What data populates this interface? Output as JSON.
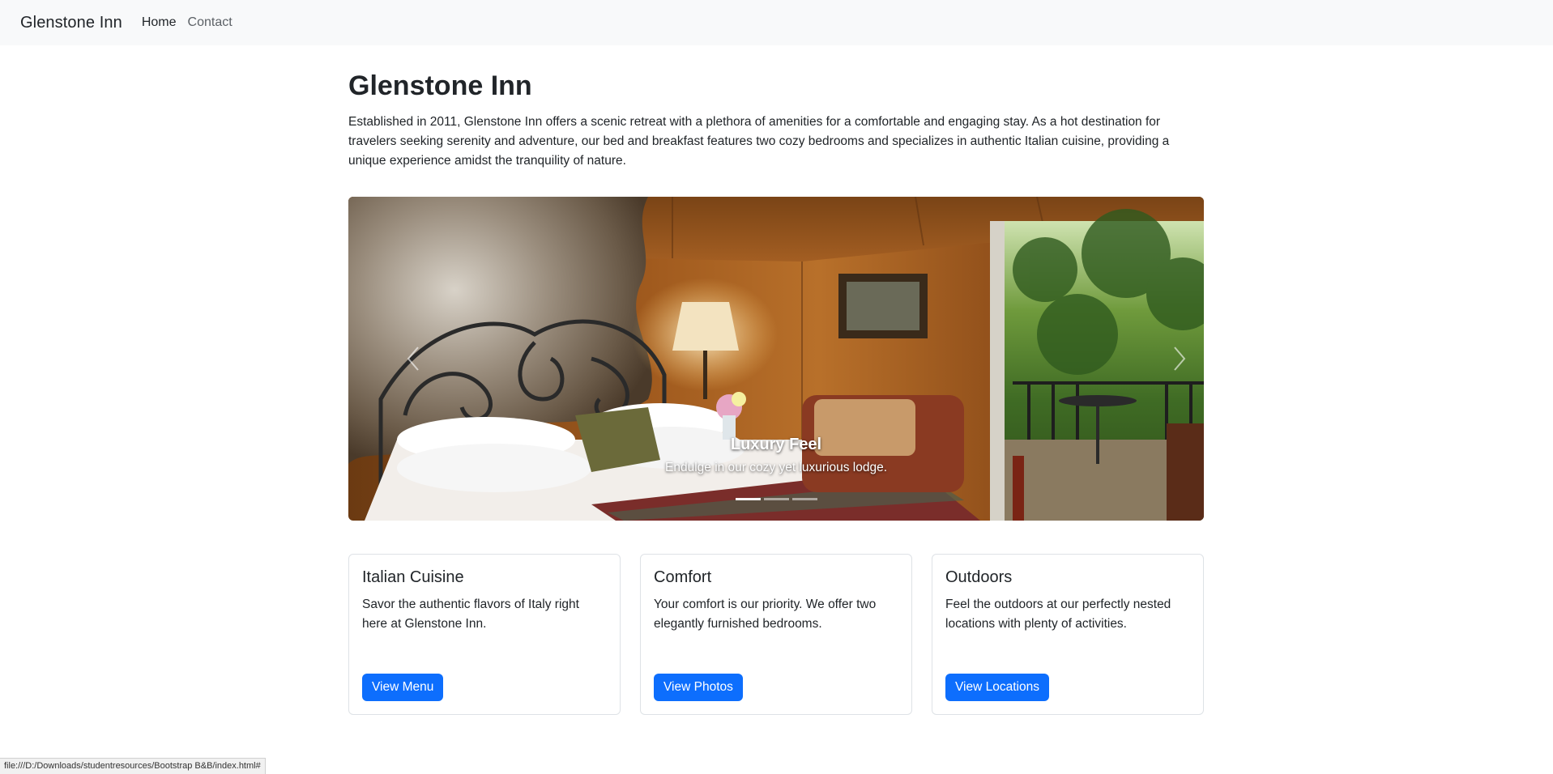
{
  "navbar": {
    "brand": "Glenstone Inn",
    "links": [
      {
        "label": "Home",
        "active": true
      },
      {
        "label": "Contact",
        "active": false
      }
    ]
  },
  "main": {
    "title": "Glenstone Inn",
    "intro": "Established in 2011, Glenstone Inn offers a scenic retreat with a plethora of amenities for a comfortable and engaging stay. As a hot destination for travelers seeking serenity and adventure, our bed and breakfast features two cozy bedrooms and specializes in authentic Italian cuisine, providing a unique experience amidst the tranquility of nature."
  },
  "carousel": {
    "slide_count": 3,
    "active_index": 0,
    "caption_title": "Luxury Feel",
    "caption_text": "Endulge in our cozy yet luxurious lodge."
  },
  "cards": [
    {
      "title": "Italian Cuisine",
      "text": "Savor the authentic flavors of Italy right here at Glenstone Inn.",
      "button": "View Menu"
    },
    {
      "title": "Comfort",
      "text": "Your comfort is our priority. We offer two elegantly furnished bedrooms.",
      "button": "View Photos"
    },
    {
      "title": "Outdoors",
      "text": "Feel the outdoors at our perfectly nested locations with plenty of activities.",
      "button": "View Locations"
    }
  ],
  "status_bar": {
    "url": "file:///D:/Downloads/studentresources/Bootstrap B&B/index.html#"
  },
  "colors": {
    "primary": "#0d6efd",
    "navbar_bg": "#f8f9fa",
    "text": "#212529"
  }
}
